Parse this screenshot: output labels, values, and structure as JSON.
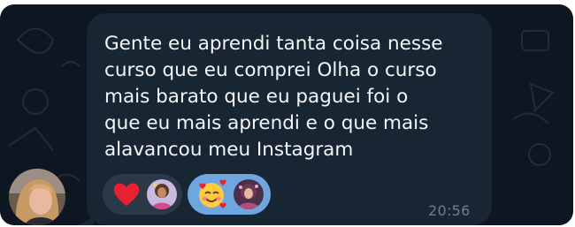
{
  "message": {
    "lines": [
      "Gente eu aprendi tanta coisa nesse",
      "curso que eu comprei Olha o curso",
      "mais barato que eu paguei foi o",
      "que eu mais aprendi e o que mais",
      "alavancou meu Instagram"
    ],
    "time": "20:56"
  },
  "sender": {
    "avatar_icon": "user-avatar-photo"
  },
  "reactions": [
    {
      "emoji_icon": "red-heart-icon",
      "reactor_icon": "reactor-avatar-icon",
      "selected": false
    },
    {
      "emoji_icon": "smiling-face-with-hearts-icon",
      "reactor_icon": "reactor-avatar-icon",
      "selected": true
    }
  ],
  "colors": {
    "chat_background": "#0e1621",
    "bubble": "#182533",
    "text": "#f5f6f7",
    "time": "#6d7f8f",
    "reaction_default": "#2a3847",
    "reaction_selected": "#6ea7e0"
  }
}
